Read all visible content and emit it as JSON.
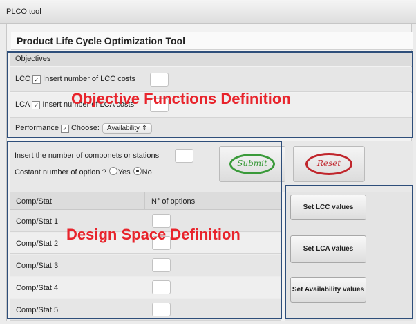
{
  "window": {
    "title": "PLCO tool"
  },
  "app": {
    "header": "Product Life Cycle Optimization Tool"
  },
  "objectives": {
    "header": "Objectives",
    "lcc_label": "LCC",
    "lcc_text": "Insert number of LCC costs",
    "lca_label": "LCA",
    "lca_text": "Insert number of LCA costs",
    "performance_label": "Performance",
    "choose_label": "Choose:",
    "choose_value": "Availability",
    "checkmark": "✓"
  },
  "design": {
    "components_label": "Insert the number of componets or stations",
    "constant_label": "Costant number of option ?",
    "yes_label": "Yes",
    "no_label": "No",
    "col_comp": "Comp/Stat",
    "col_options": "N° of options",
    "rows": [
      "Comp/Stat 1",
      "Comp/Stat 2",
      "Comp/Stat 3",
      "Comp/Stat 4",
      "Comp/Stat 5"
    ]
  },
  "buttons": {
    "submit": "Submit",
    "reset": "Reset",
    "set_lcc": "Set LCC values",
    "set_lca": "Set LCA values",
    "set_availability": "Set Availability values"
  },
  "overlays": {
    "objective_functions": "Objective Functions Definition",
    "design_space": "Design Space Definition"
  },
  "colors": {
    "overlay_text": "#e8242c",
    "overlay_border": "#2e4e7a",
    "submit": "#3a9a3a",
    "reset": "#c0262c"
  }
}
